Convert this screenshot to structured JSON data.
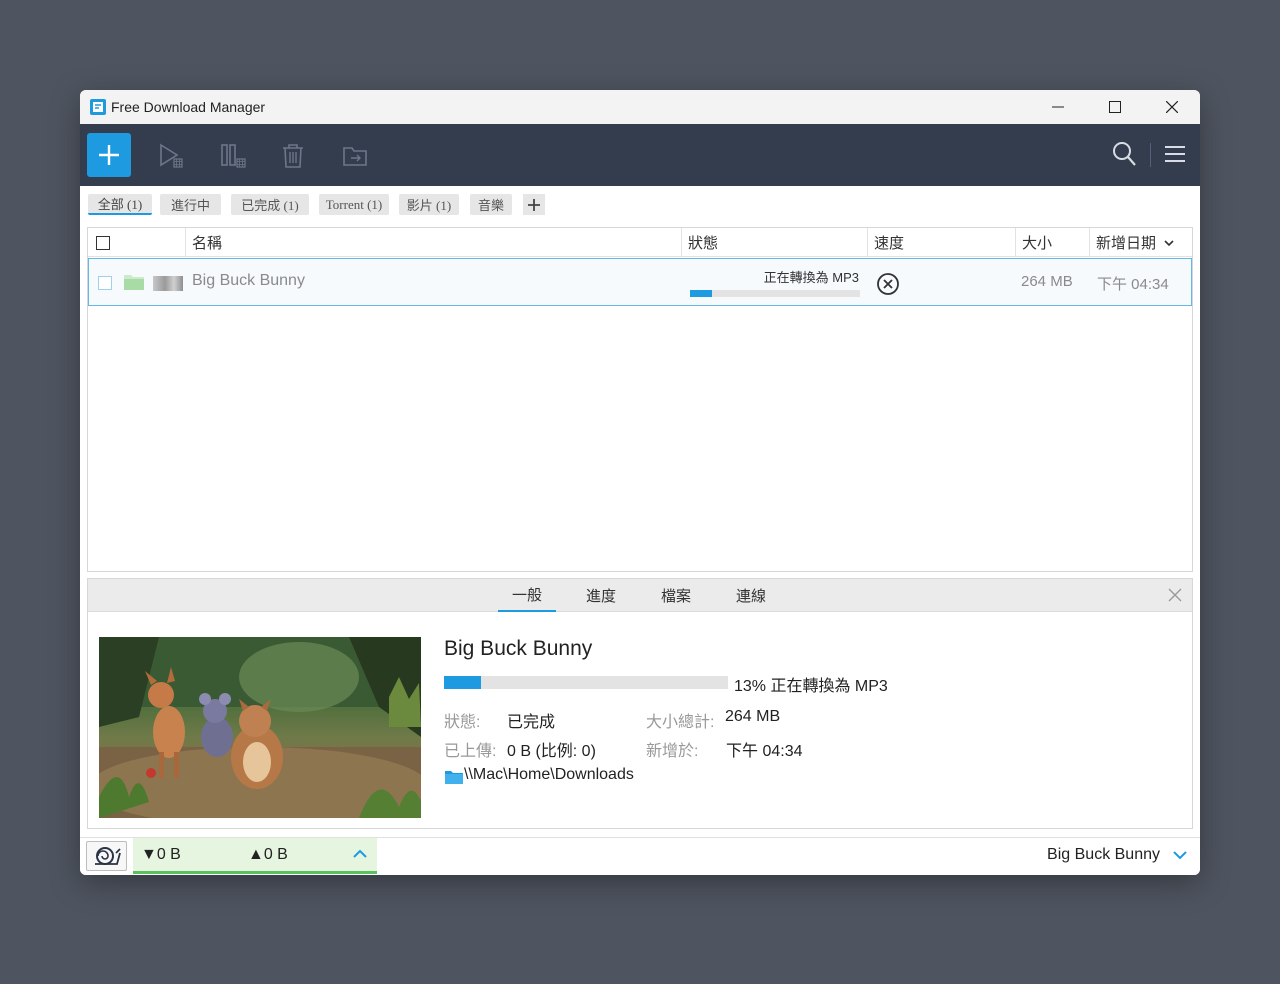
{
  "app": {
    "title": "Free Download Manager"
  },
  "filters": [
    {
      "label": "全部 (1)",
      "active": true
    },
    {
      "label": "進行中",
      "active": false
    },
    {
      "label": "已完成 (1)",
      "active": false
    },
    {
      "label": "Torrent (1)",
      "active": false
    },
    {
      "label": "影片 (1)",
      "active": false
    },
    {
      "label": "音樂",
      "active": false
    }
  ],
  "table": {
    "columns": {
      "name": "名稱",
      "status": "狀態",
      "speed": "速度",
      "size": "大小",
      "date": "新增日期"
    },
    "rows": [
      {
        "name": "Big Buck Bunny",
        "status": "正在轉換為 MP3",
        "progress": 0.13,
        "size": "264 MB",
        "date": "下午 04:34"
      }
    ]
  },
  "detail": {
    "tabs": [
      "一般",
      "進度",
      "檔案",
      "連線"
    ],
    "active_tab": "一般",
    "title": "Big Buck Bunny",
    "progress": 0.13,
    "progress_text": "13% 正在轉換為 MP3",
    "status_label": "狀態:",
    "status_value": "已完成",
    "total_size_label": "大小總計:",
    "total_size_value": "264 MB",
    "uploaded_label": "已上傳:",
    "uploaded_value": "0 B (比例: 0)",
    "added_label": "新增於:",
    "added_value": "下午 04:34",
    "path": "\\\\Mac\\Home\\Downloads"
  },
  "statusbar": {
    "download_speed": "▼0 B",
    "upload_speed": "▲0 B",
    "selected_name": "Big Buck Bunny"
  },
  "colors": {
    "accent": "#1e9ae0",
    "toolbar_bg": "#333d4e",
    "speed_ok": "#5ac060"
  }
}
